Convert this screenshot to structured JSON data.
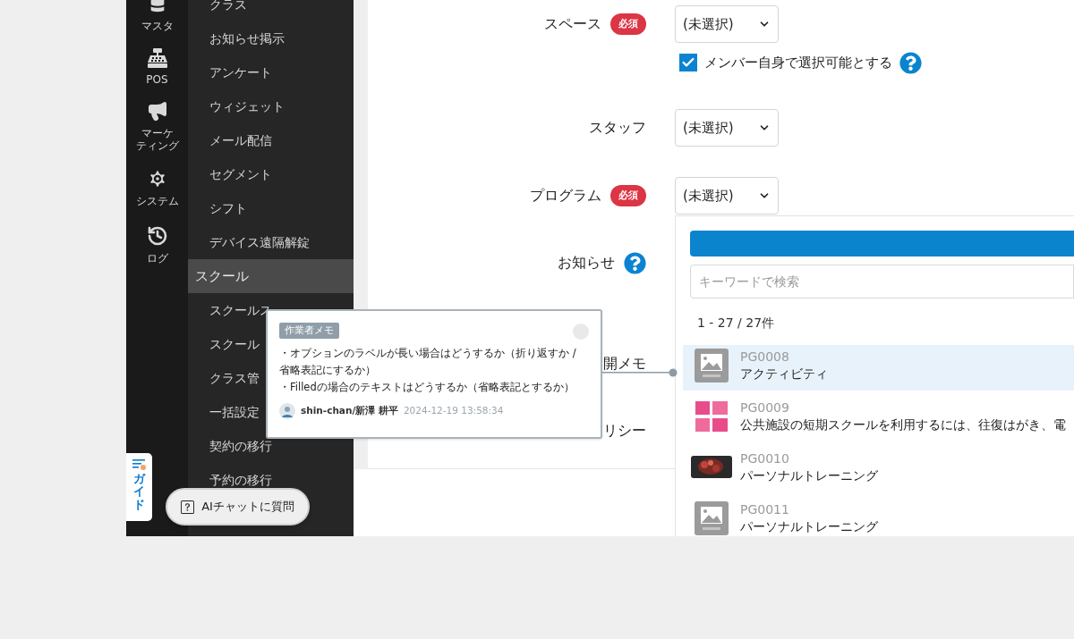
{
  "rail": {
    "items": [
      {
        "lines": [
          "マスタ"
        ],
        "kind": "database"
      },
      {
        "lines": [
          "POS"
        ],
        "kind": "register"
      },
      {
        "lines": [
          "マーケ",
          "ティング"
        ],
        "kind": "megaphone"
      },
      {
        "lines": [
          "システム"
        ],
        "kind": "gear"
      },
      {
        "lines": [
          "ログ"
        ],
        "kind": "history"
      }
    ]
  },
  "submenu": {
    "items": [
      {
        "label": "クラス",
        "kind": "link"
      },
      {
        "label": "お知らせ掲示",
        "kind": "link"
      },
      {
        "label": "アンケート",
        "kind": "link"
      },
      {
        "label": "ウィジェット",
        "kind": "link"
      },
      {
        "label": "メール配信",
        "kind": "link"
      },
      {
        "label": "セグメント",
        "kind": "link"
      },
      {
        "label": "シフト",
        "kind": "link"
      },
      {
        "label": "デバイス遠隔解錠",
        "kind": "link"
      },
      {
        "label": "スクール",
        "kind": "section"
      },
      {
        "label": "スクールス",
        "kind": "link"
      },
      {
        "label": "スクール",
        "kind": "link"
      },
      {
        "label": "クラス管",
        "kind": "link"
      },
      {
        "label": "一括設定",
        "kind": "link"
      },
      {
        "label": "契約の移行",
        "kind": "link"
      },
      {
        "label": "予約の移行",
        "kind": "link"
      }
    ]
  },
  "guide_tab": {
    "label": "ガイド"
  },
  "ai_chat_button": {
    "label": "AIチャットに質問"
  },
  "form": {
    "fields": [
      {
        "label": "スペース",
        "badge": "必須",
        "kind": "select",
        "value": "(未選択)",
        "option": {
          "label": "メンバー自身で選択可能とする",
          "checked": true
        }
      },
      {
        "label": "スタッフ",
        "kind": "select",
        "value": "(未選択)"
      },
      {
        "label": "プログラム",
        "badge": "必須",
        "kind": "select",
        "value": "(未選択)"
      },
      {
        "label": "お知らせ",
        "kind": "help"
      },
      {
        "label": "開メモ",
        "kind": "none"
      },
      {
        "label": "リシー",
        "kind": "none"
      }
    ]
  },
  "program_dropdown": {
    "search": {
      "placeholder": "キーワードで検索"
    },
    "count": "1 - 27 / 27件",
    "items": [
      {
        "code": "PG0008",
        "name": "アクティビティ",
        "kind": "placeholder",
        "selected": true
      },
      {
        "code": "PG0009",
        "name": "公共施設の短期スクールを利用するには、往復はがき、電",
        "kind": "banner",
        "selected": false
      },
      {
        "code": "PG0010",
        "name": "パーソナルトレーニング",
        "selected": false
      },
      {
        "code": "PG0011",
        "name": "パーソナルトレーニング",
        "kind": "placeholder",
        "selected": false
      }
    ]
  },
  "memo": {
    "tag": "作業者メモ",
    "lines": [
      "・オプションのラベルが長い場合はどうするか（折り返すか / 省略表記にするか）",
      "・Filledの場合のテキストはどうするか（省略表記とするか）"
    ],
    "author": "shin-chan/新澤 耕平",
    "time": "2024-12-19 13:58:34"
  }
}
